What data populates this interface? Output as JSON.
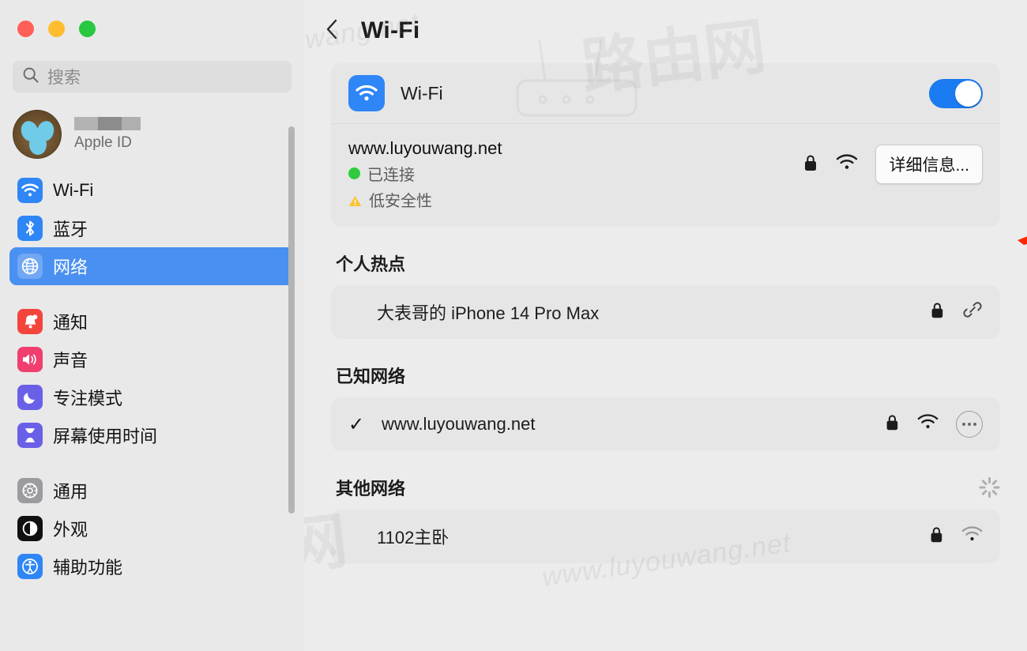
{
  "window": {
    "traffic_lights": [
      "close",
      "minimize",
      "zoom"
    ],
    "colors": {
      "close": "#FF5F57",
      "minimize": "#FEBC2E",
      "zoom": "#28C840",
      "accent": "#1B7BF2",
      "selected": "#4A90F0",
      "annotation": "#FA2800"
    }
  },
  "sidebar": {
    "search": {
      "placeholder": "搜索",
      "icon": "search-icon"
    },
    "account": {
      "name_redacted": "",
      "subtitle": "Apple ID",
      "avatar": "bird-nest-avatar"
    },
    "items": [
      {
        "label": "Wi-Fi",
        "icon": "wifi-icon",
        "color": "#2F86F6",
        "selected": false
      },
      {
        "label": "蓝牙",
        "icon": "bluetooth-icon",
        "color": "#2F86F6",
        "selected": false
      },
      {
        "label": "网络",
        "icon": "globe-icon",
        "color": "#4A90F0",
        "selected": true
      },
      {
        "label": "通知",
        "icon": "bell-icon",
        "color": "#F4453C",
        "selected": false
      },
      {
        "label": "声音",
        "icon": "speaker-icon",
        "color": "#F03E6E",
        "selected": false
      },
      {
        "label": "专注模式",
        "icon": "moon-icon",
        "color": "#6A60E8",
        "selected": false
      },
      {
        "label": "屏幕使用时间",
        "icon": "hourglass-icon",
        "color": "#6A60E8",
        "selected": false
      },
      {
        "label": "通用",
        "icon": "gear-icon",
        "color": "#9B9BA0",
        "selected": false
      },
      {
        "label": "外观",
        "icon": "appearance-icon",
        "color": "#101010",
        "selected": false
      },
      {
        "label": "辅助功能",
        "icon": "accessibility-icon",
        "color": "#2F86F6",
        "selected": false
      }
    ]
  },
  "main": {
    "back_icon": "chevron-left-icon",
    "title": "Wi-Fi",
    "wifi_toggle": {
      "label": "Wi-Fi",
      "icon": "wifi-icon",
      "state": "on"
    },
    "current_network": {
      "name": "www.luyouwang.net",
      "status": "已连接",
      "security_warning": "低安全性",
      "icons": [
        "lock-icon",
        "wifi-signal-icon"
      ],
      "details_button": "详细信息..."
    },
    "hotspot": {
      "section_title": "个人热点",
      "name": "大表哥的 iPhone 14 Pro Max",
      "icons": [
        "lock-icon",
        "link-icon"
      ]
    },
    "known_networks": {
      "section_title": "已知网络",
      "rows": [
        {
          "name": "www.luyouwang.net",
          "checked": "✓",
          "icons": [
            "lock-icon",
            "wifi-signal-icon",
            "more-icon"
          ]
        }
      ]
    },
    "other_networks": {
      "section_title": "其他网络",
      "loading_icon": "spinner-icon",
      "rows": [
        {
          "name": "1102主卧",
          "icons": [
            "lock-icon",
            "wifi-signal-icon"
          ]
        }
      ]
    }
  },
  "watermarks": {
    "text": "www.luyouwang.net",
    "cn": "路由网"
  }
}
